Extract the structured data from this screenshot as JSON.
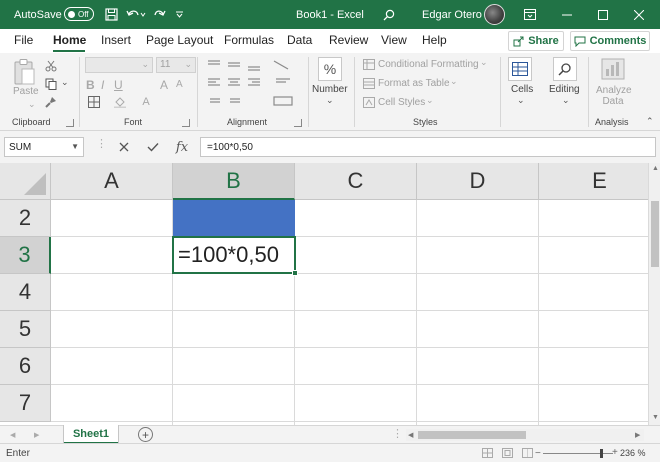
{
  "titlebar": {
    "autosave_label": "AutoSave",
    "autosave_state": "Off",
    "window_title": "Book1  -  Excel",
    "user_name": "Edgar Otero"
  },
  "menu": {
    "tabs": [
      "File",
      "Home",
      "Insert",
      "Page Layout",
      "Formulas",
      "Data",
      "Review",
      "View",
      "Help"
    ],
    "share_label": "Share",
    "comments_label": "Comments"
  },
  "ribbon": {
    "clipboard": {
      "paste_label": "Paste",
      "group_label": "Clipboard"
    },
    "font": {
      "size_value": "11",
      "group_label": "Font"
    },
    "alignment": {
      "group_label": "Alignment"
    },
    "number": {
      "label": "Number",
      "symbol": "%"
    },
    "styles": {
      "conditional_formatting": "Conditional Formatting",
      "format_as_table": "Format as Table",
      "cell_styles": "Cell Styles",
      "group_label": "Styles"
    },
    "cells": {
      "label": "Cells"
    },
    "editing": {
      "label": "Editing"
    },
    "analysis": {
      "analyze_data": "Analyze Data",
      "group_label": "Analysis"
    }
  },
  "formula_bar": {
    "name_box": "SUM",
    "fx": "fx",
    "formula": "=100*0,50"
  },
  "grid": {
    "columns": [
      "A",
      "B",
      "C",
      "D",
      "E"
    ],
    "rows": [
      "2",
      "3",
      "4",
      "5",
      "6",
      "7"
    ],
    "selected_column": "B",
    "selected_row": "3",
    "active_cell_text": "=100*0,50",
    "fill_color": "#4472c4"
  },
  "sheets": {
    "tabs": [
      "Sheet1"
    ]
  },
  "status": {
    "mode": "Enter",
    "zoom": "236 %"
  },
  "colors": {
    "brand": "#217346",
    "cell_fill": "#4472c4"
  }
}
